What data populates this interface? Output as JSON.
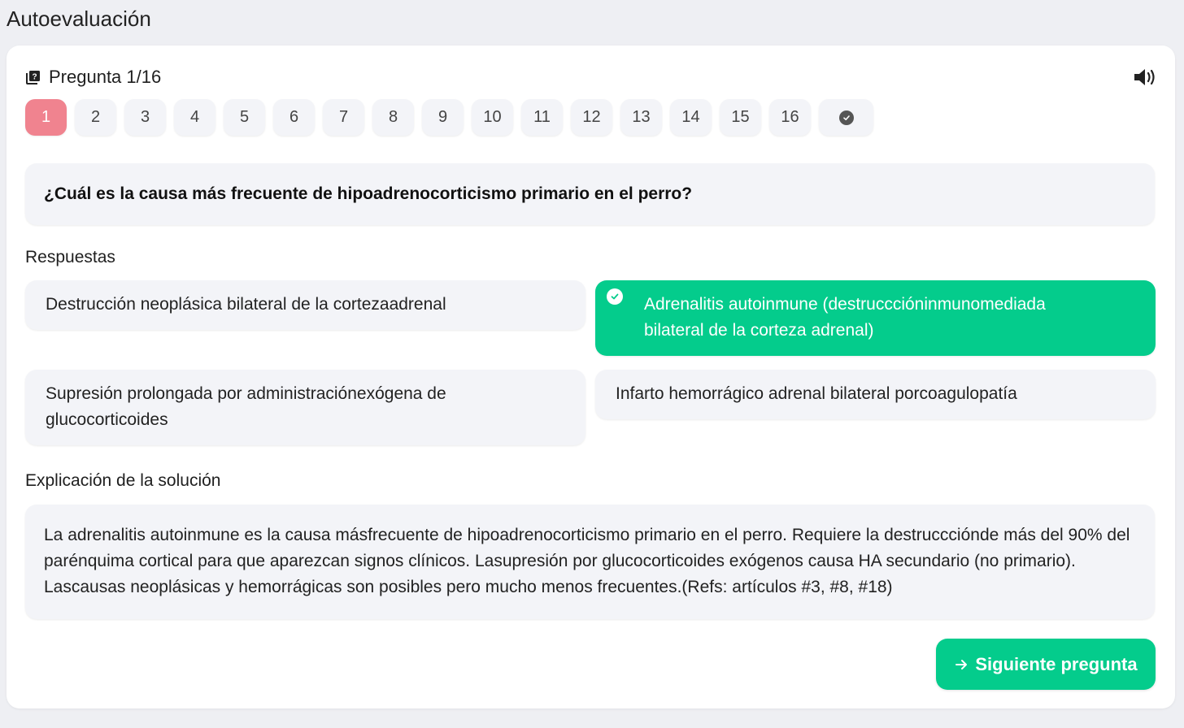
{
  "page": {
    "title": "Autoevaluación"
  },
  "quiz": {
    "header": "Pregunta 1/16",
    "numbers": [
      "1",
      "2",
      "3",
      "4",
      "5",
      "6",
      "7",
      "8",
      "9",
      "10",
      "11",
      "12",
      "13",
      "14",
      "15",
      "16"
    ],
    "active_index": 0,
    "question": "¿Cuál es la causa más frecuente de hipoadrenocorticismo primario en el perro?",
    "answers_label": "Respuestas",
    "answers": [
      {
        "text": "Destrucción neoplásica bilateral de la cortezaadrenal",
        "correct": false
      },
      {
        "text": "Adrenalitis autoinmune (destrucccióninmunomediada bilateral de la corteza adrenal)",
        "correct": true
      },
      {
        "text": "Supresión prolongada por administraciónexógena de glucocorticoides",
        "correct": false
      },
      {
        "text": "Infarto hemorrágico adrenal bilateral porcoagulopatía",
        "correct": false
      }
    ],
    "explanation_label": "Explicación de la solución",
    "explanation": "La adrenalitis autoinmune es la causa másfrecuente de hipoadrenocorticismo primario en el perro. Requiere la destruccciónde más del 90% del parénquima cortical para que aparezcan signos clínicos. Lasupresión por glucocorticoides exógenos causa HA secundario (no primario). Lascausas neoplásicas y hemorrágicas son posibles pero mucho menos frecuentes.(Refs: artículos #3, #8, #18)",
    "next_label": "Siguiente pregunta"
  },
  "icons": {
    "header": "book-question-icon",
    "speaker": "speaker-icon",
    "finish": "check-circle-icon",
    "correct": "check-circle-icon",
    "next": "arrow-right-icon"
  },
  "colors": {
    "accent": "#04cc8c",
    "active_number": "#f0838f",
    "tile": "#f3f4f8",
    "background": "#eeeff3"
  }
}
